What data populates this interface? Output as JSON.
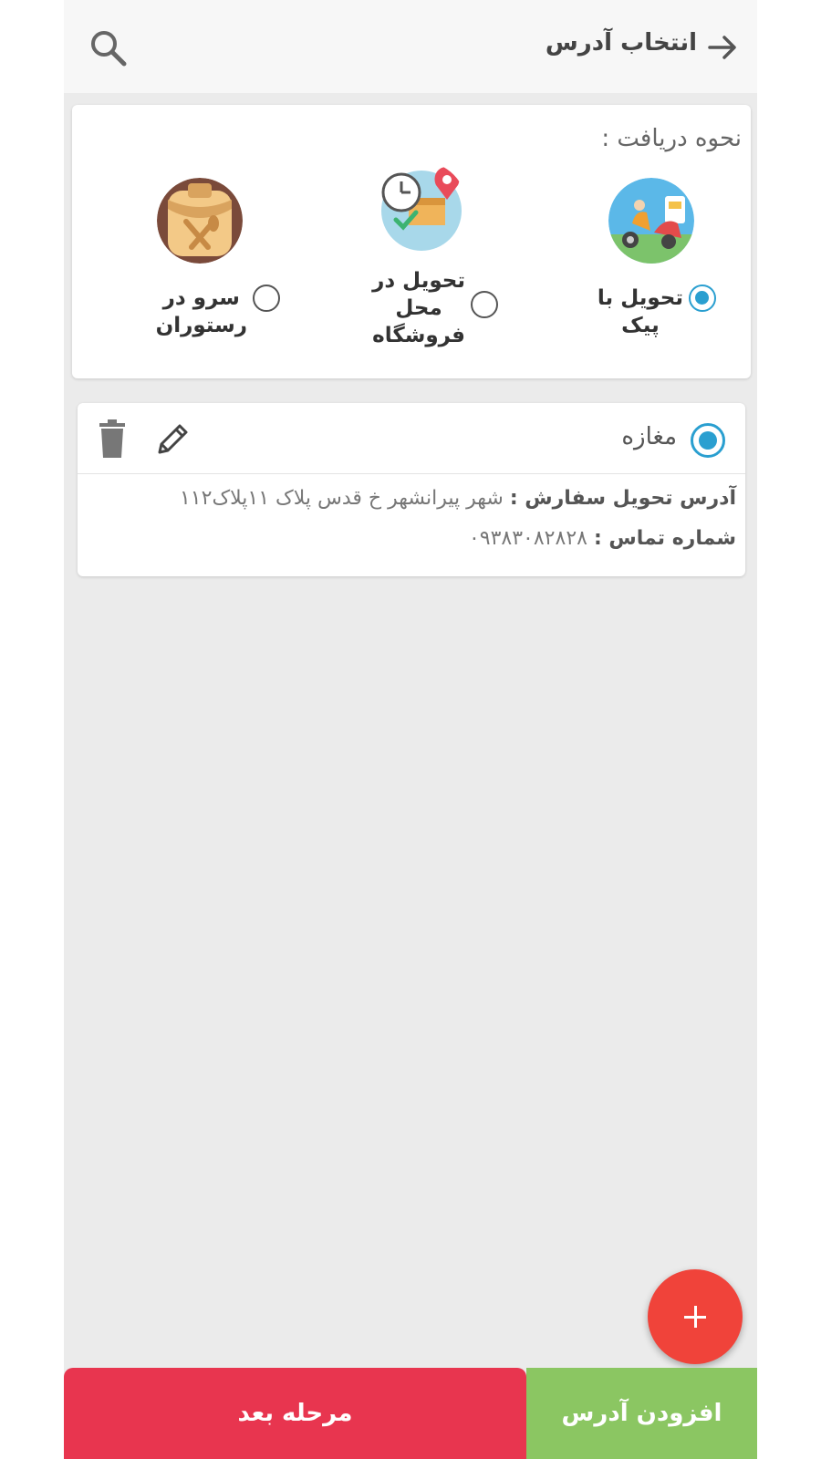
{
  "header": {
    "title": "انتخاب آدرس",
    "back_icon": "arrow-right-icon",
    "search_icon": "search-icon"
  },
  "delivery": {
    "label": "نحوه دریافت :",
    "options": [
      {
        "line1": "تحویل با",
        "line2": "پیک",
        "line3": "",
        "selected": true,
        "icon": "courier-scooter-icon"
      },
      {
        "line1": "تحویل در",
        "line2": "محل",
        "line3": "فروشگاه",
        "selected": false,
        "icon": "store-pickup-icon"
      },
      {
        "line1": "سرو در",
        "line2": "رستوران",
        "line3": "",
        "selected": false,
        "icon": "restaurant-icon"
      }
    ]
  },
  "address": {
    "name": "مغازه",
    "selected": true,
    "address_label": "آدرس تحویل سفارش :",
    "address_value": "شهر پیرانشهر خ قدس پلاک ۱۱پلاک۱۱۲",
    "phone_label": "شماره تماس :",
    "phone_value": "۰۹۳۸۳۰۸۲۸۲۸",
    "edit_icon": "pencil-icon",
    "delete_icon": "trash-icon"
  },
  "actions": {
    "next_label": "مرحله بعد",
    "add_address_label": "افزودن آدرس",
    "fab_icon": "plus-icon"
  },
  "colors": {
    "accent_radio": "#2a9fd0",
    "next_button": "#e8354f",
    "add_button": "#8bc662",
    "fab": "#f0433a"
  }
}
